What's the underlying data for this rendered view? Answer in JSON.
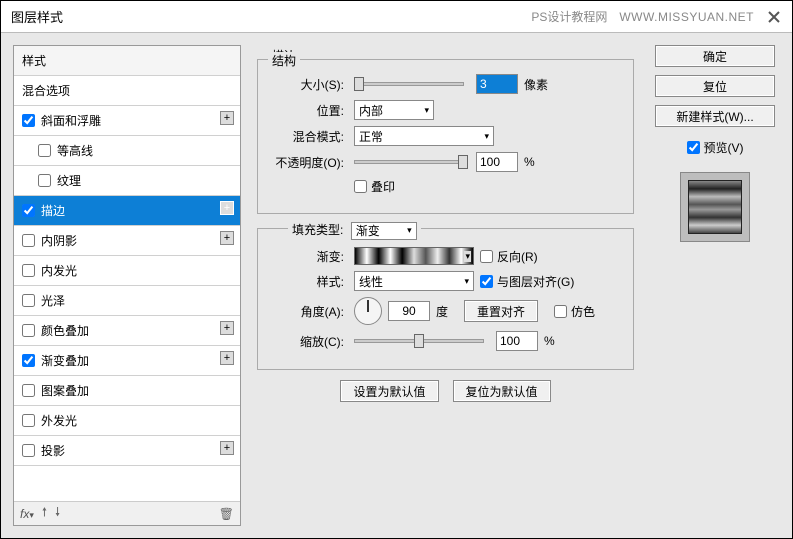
{
  "title": "图层样式",
  "watermark": {
    "site": "PS设计教程网",
    "url": "WWW.MISSYUAN.NET"
  },
  "sidebar": {
    "header": "样式",
    "blend_options": "混合选项",
    "items": [
      {
        "label": "斜面和浮雕",
        "checked": true,
        "add": true
      },
      {
        "label": "等高线",
        "checked": false,
        "indent": true
      },
      {
        "label": "纹理",
        "checked": false,
        "indent": true
      },
      {
        "label": "描边",
        "checked": true,
        "selected": true,
        "add": true
      },
      {
        "label": "内阴影",
        "checked": false,
        "add": true
      },
      {
        "label": "内发光",
        "checked": false
      },
      {
        "label": "光泽",
        "checked": false
      },
      {
        "label": "颜色叠加",
        "checked": false,
        "add": true
      },
      {
        "label": "渐变叠加",
        "checked": true,
        "add": true
      },
      {
        "label": "图案叠加",
        "checked": false
      },
      {
        "label": "外发光",
        "checked": false
      },
      {
        "label": "投影",
        "checked": false,
        "add": true
      }
    ],
    "footer_fx": "fx"
  },
  "main": {
    "stroke_title": "描边",
    "structure_title": "结构",
    "size_label": "大小(S):",
    "size_value": "3",
    "size_unit": "像素",
    "position_label": "位置:",
    "position_value": "内部",
    "blend_label": "混合模式:",
    "blend_value": "正常",
    "opacity_label": "不透明度(O):",
    "opacity_value": "100",
    "opacity_unit": "%",
    "overprint_label": "叠印",
    "filltype_label": "填充类型:",
    "filltype_value": "渐变",
    "gradient_label": "渐变:",
    "reverse_label": "反向(R)",
    "style_label": "样式:",
    "style_value": "线性",
    "align_label": "与图层对齐(G)",
    "angle_label": "角度(A):",
    "angle_value": "90",
    "angle_unit": "度",
    "reset_align": "重置对齐",
    "dither_label": "仿色",
    "scale_label": "缩放(C):",
    "scale_value": "100",
    "scale_unit": "%",
    "set_default": "设置为默认值",
    "reset_default": "复位为默认值"
  },
  "buttons": {
    "ok": "确定",
    "cancel": "复位",
    "new_style": "新建样式(W)...",
    "preview": "预览(V)"
  }
}
